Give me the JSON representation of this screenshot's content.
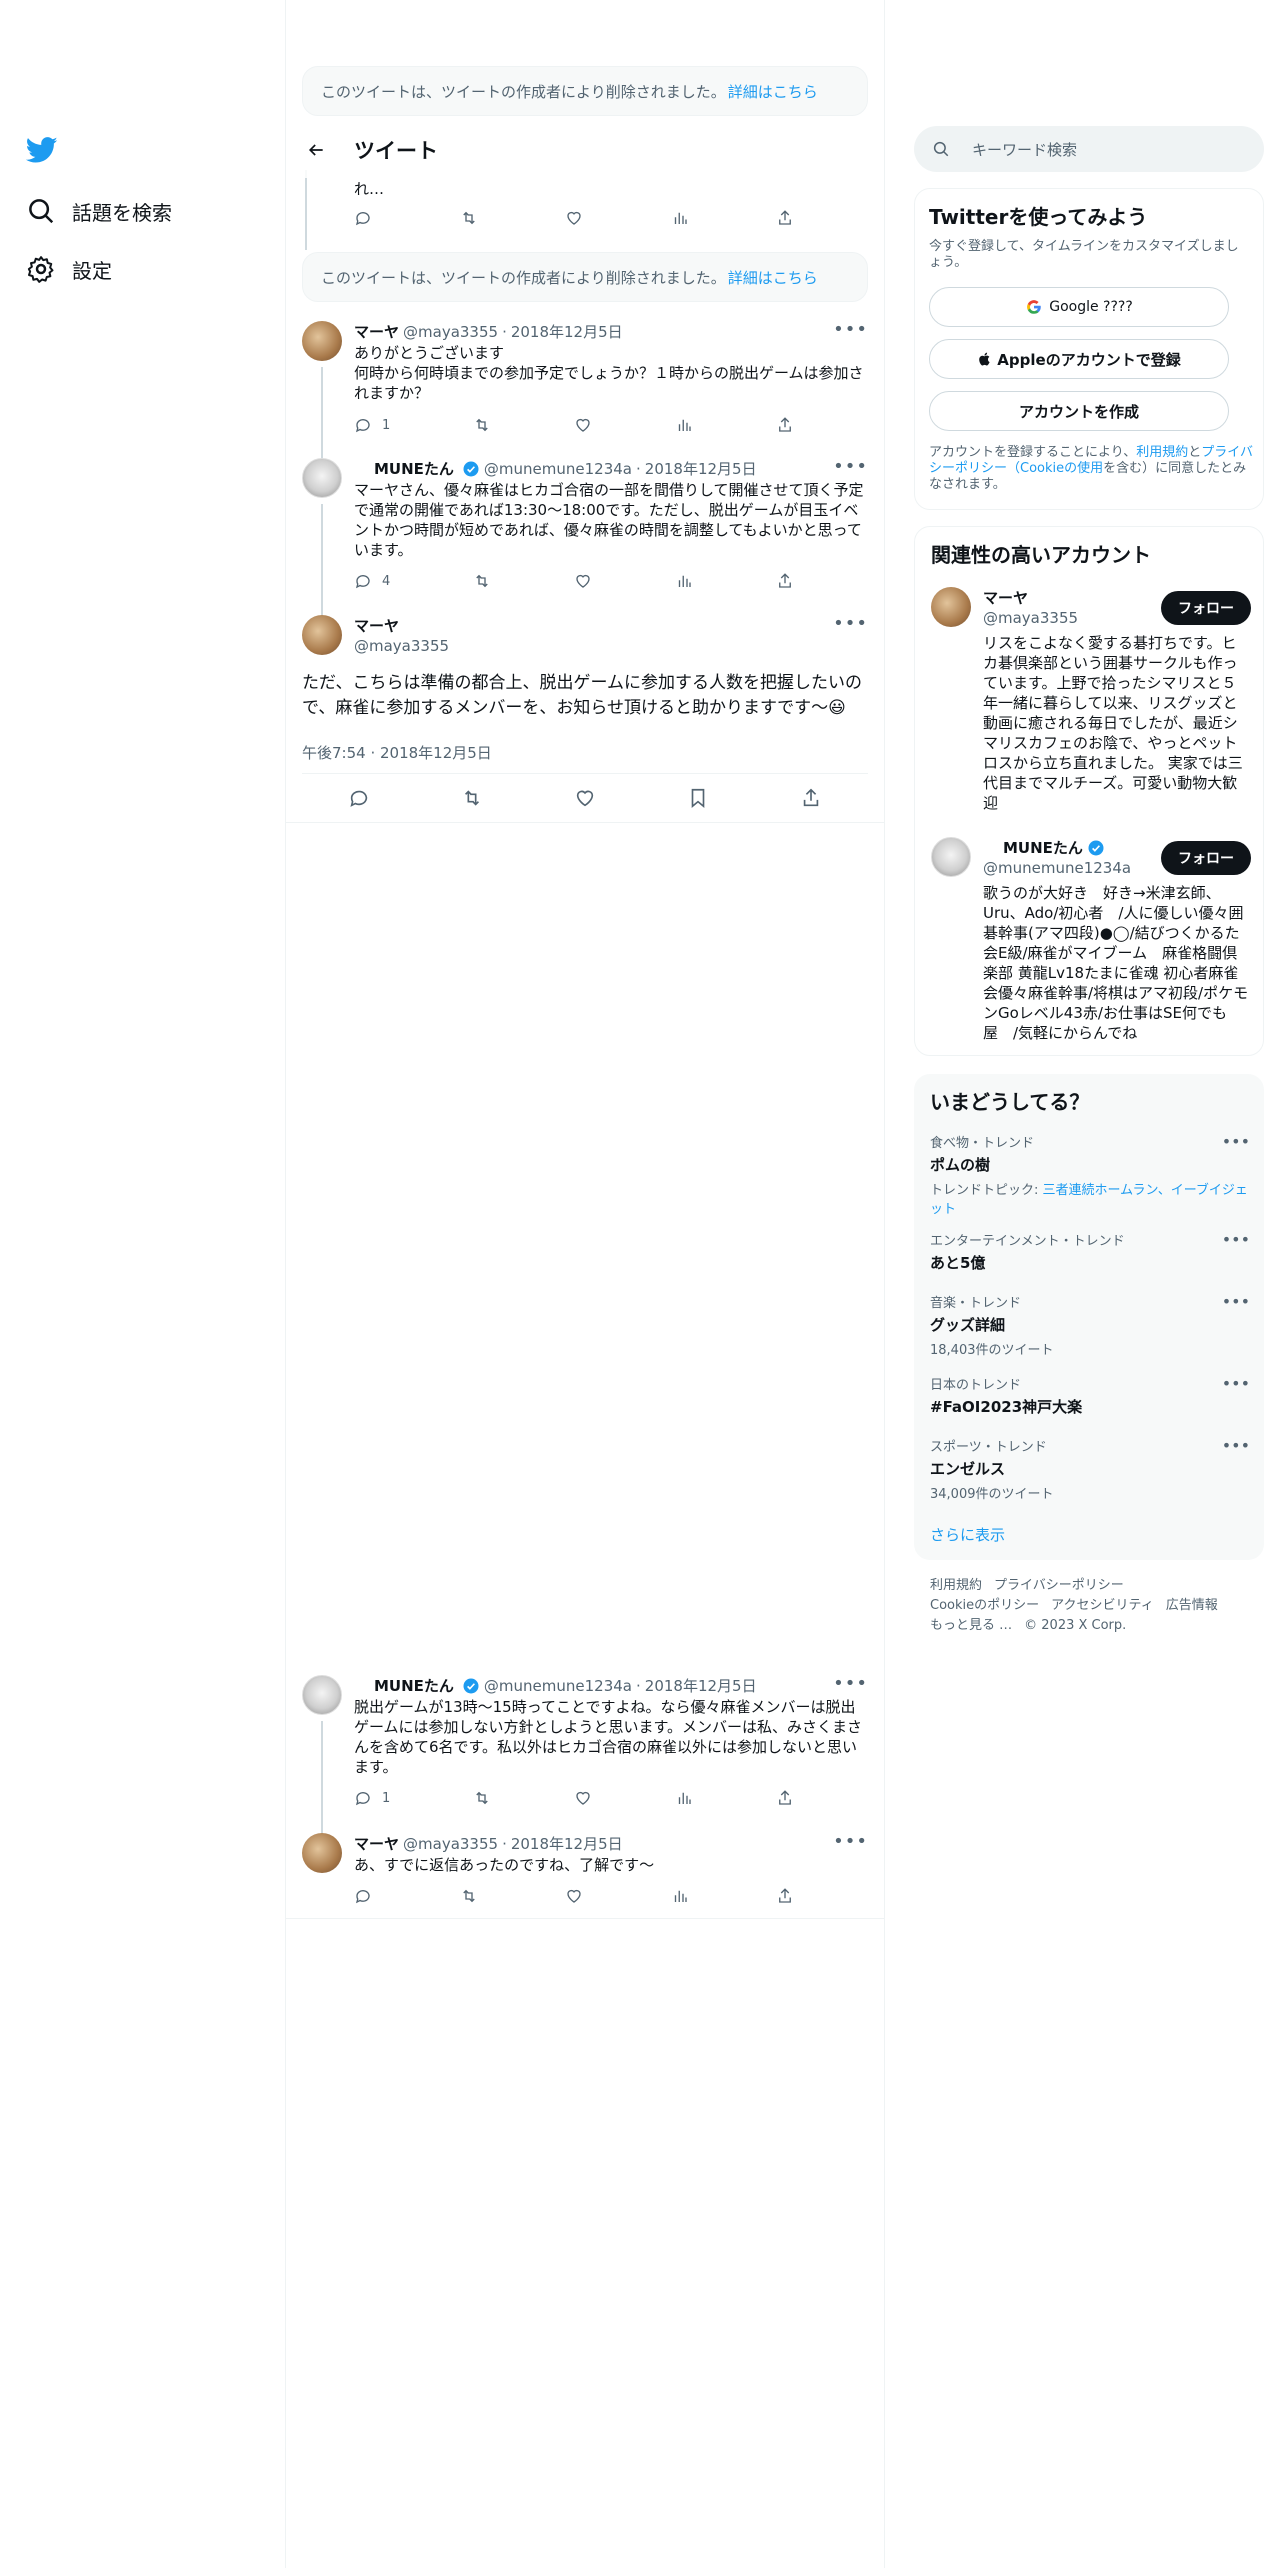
{
  "nav": {
    "items": [
      {
        "label": "話題を検索",
        "icon": "search-icon"
      },
      {
        "label": "設定",
        "icon": "gear-icon"
      }
    ]
  },
  "header": {
    "title": "ツイート"
  },
  "deleted_notice": {
    "text": "このツイートは、ツイートの作成者により削除されました。",
    "link": "詳細はこちら"
  },
  "partial_tweet": {
    "text": "れ…"
  },
  "tweets": [
    {
      "name": "マーヤ",
      "handle": "@maya3355",
      "date": "2018年12月5日",
      "text": "ありがとうございます\n何時から何時頃までの参加予定でしょうか？１時からの脱出ゲームは参加されますか？",
      "replies": "1"
    },
    {
      "name": "MUNEたん",
      "handle": "@munemune1234a",
      "date": "2018年12月5日",
      "text": "マーヤさん、優々麻雀はヒカゴ合宿の一部を間借りして開催させて頂く予定で通常の開催であれば13:30〜18:00です。ただし、脱出ゲームが目玉イベントかつ時間が短めであれば、優々麻雀の時間を調整してもよいかと思っています。",
      "replies": "4"
    },
    {
      "name": "MUNEたん",
      "handle": "@munemune1234a",
      "date": "2018年12月5日",
      "text": "脱出ゲームが13時〜15時ってことですよね。なら優々麻雀メンバーは脱出ゲームには参加しない方針としようと思います。メンバーは私、みさくまさんを含めて6名です。私以外はヒカゴ合宿の麻雀以外には参加しないと思います。",
      "replies": "1"
    },
    {
      "name": "マーヤ",
      "handle": "@maya3355",
      "date": "2018年12月5日",
      "text": "あ、すでに返信あったのですね、了解です〜",
      "replies": ""
    }
  ],
  "focus_tweet": {
    "name": "マーヤ",
    "handle": "@maya3355",
    "text": "ただ、こちらは準備の都合上、脱出ゲームに参加する人数を把握したいので、麻雀に参加するメンバーを、お知らせ頂けると助かりますです〜😃",
    "time": "午後7:54 · 2018年12月5日"
  },
  "search": {
    "placeholder": "キーワード検索"
  },
  "signup": {
    "title": "Twitterを使ってみよう",
    "subtitle": "今すぐ登録して、タイムラインをカスタマイズしましょう。",
    "google_label": "Google ????",
    "apple_label": "Appleのアカウントで登録",
    "create_label": "アカウントを作成",
    "legal_prefix": "アカウントを登録することにより、",
    "legal_terms": "利用規約",
    "legal_and": "と",
    "legal_privacy": "プライバシーポリシー（Cookieの使用",
    "legal_suffix": "を含む）に同意したとみなされます。"
  },
  "related": {
    "title": "関連性の高いアカウント",
    "follow_label": "フォロー",
    "accounts": [
      {
        "name": "マーヤ",
        "handle": "@maya3355",
        "bio": "リスをこよなく愛する碁打ちです。ヒカ碁倶楽部という囲碁サークルも作っています。上野で拾ったシマリスと５年一緒に暮らして以来、リスグッズと動画に癒される毎日でしたが、最近シマリスカフェのお陰で、やっとペットロスから立ち直れました。 実家では三代目までマルチーズ。可愛い動物大歓迎"
      },
      {
        "name": "MUNEたん",
        "handle": "@munemune1234a",
        "bio": "歌うのが大好き　好き→米津玄師、Uru、Ado/初心者　/人に優しい優々囲碁幹事(アマ四段)●◯/結びつくかるた会E級/麻雀がマイブーム　麻雀格闘倶楽部 黄龍Lv18たまに雀魂 初心者麻雀会優々麻雀幹事/将棋はアマ初段/ポケモンGoレベル43赤/お仕事はSE何でも屋　/気軽にからんでね"
      }
    ]
  },
  "trends": {
    "title": "いまどうしてる？",
    "items": [
      {
        "category": "食べ物・トレンド",
        "name": "ポムの樹",
        "sub_prefix": "トレンドトピック: ",
        "sub_link": "三者連続ホームラン、イーブイジェット"
      },
      {
        "category": "エンターテインメント・トレンド",
        "name": "あと5億",
        "sub_prefix": "",
        "sub_link": ""
      },
      {
        "category": "音楽・トレンド",
        "name": "グッズ詳細",
        "sub_prefix": "18,403件のツイート",
        "sub_link": ""
      },
      {
        "category": "日本のトレンド",
        "name": "#FaOI2023神戸大楽",
        "sub_prefix": "",
        "sub_link": ""
      },
      {
        "category": "スポーツ・トレンド",
        "name": "エンゼルス",
        "sub_prefix": "34,009件のツイート",
        "sub_link": ""
      }
    ],
    "show_more": "さらに表示"
  },
  "footer": {
    "links": [
      "利用規約",
      "プライバシーポリシー",
      "Cookieのポリシー",
      "アクセシビリティ",
      "広告情報",
      "もっと見る …"
    ],
    "copyright": "© 2023 X Corp."
  },
  "colors": {
    "accent": "#1d9bf0",
    "text": "#0f1419",
    "muted": "#536471",
    "border": "#eff3f4"
  }
}
